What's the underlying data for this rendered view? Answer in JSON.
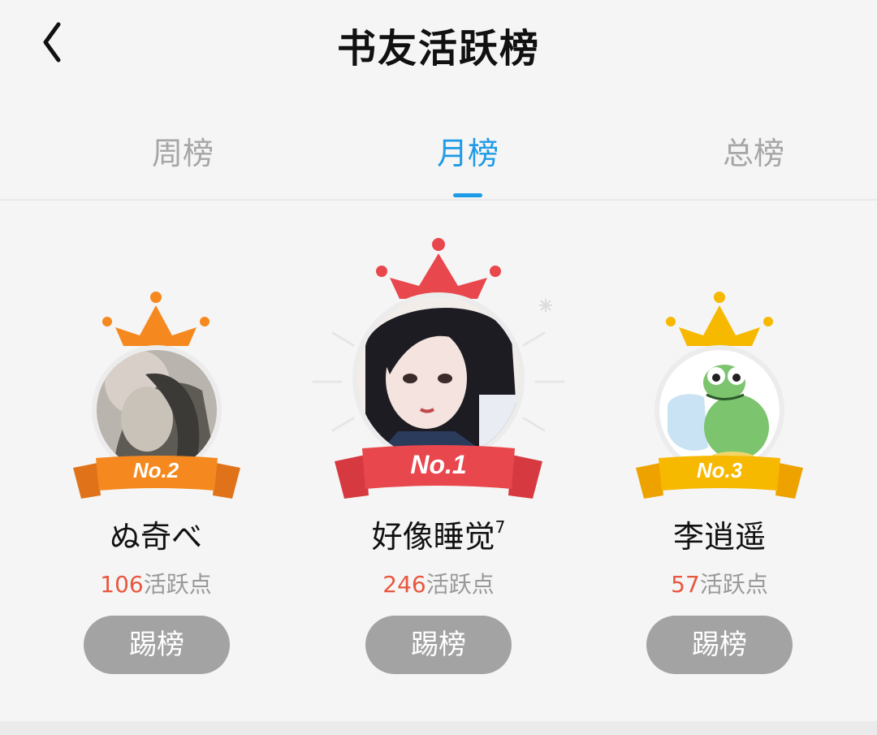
{
  "header": {
    "title": "书友活跃榜",
    "back_icon": "chevron-left-icon"
  },
  "tabs": [
    {
      "label": "周榜",
      "active": false
    },
    {
      "label": "月榜",
      "active": true
    },
    {
      "label": "总榜",
      "active": false
    }
  ],
  "colors": {
    "accent": "#1e9be6",
    "points": "#e8573f",
    "rank1": "#e8474d",
    "rank2": "#f5891f",
    "rank3": "#f7b800",
    "button": "#a3a3a3"
  },
  "leaderboard": [
    {
      "rank_label": "No.2",
      "name": "ぬ奇べ",
      "points": "106",
      "points_suffix": "活跃点",
      "action": "踢榜",
      "crown_icon": "crown-icon",
      "avatar": "user-avatar"
    },
    {
      "rank_label": "No.1",
      "name": "好像睡觉",
      "name_sup": "7",
      "points": "246",
      "points_suffix": "活跃点",
      "action": "踢榜",
      "crown_icon": "crown-icon",
      "avatar": "user-avatar"
    },
    {
      "rank_label": "No.3",
      "name": "李逍遥",
      "points": "57",
      "points_suffix": "活跃点",
      "action": "踢榜",
      "crown_icon": "crown-icon",
      "avatar": "user-avatar"
    }
  ]
}
